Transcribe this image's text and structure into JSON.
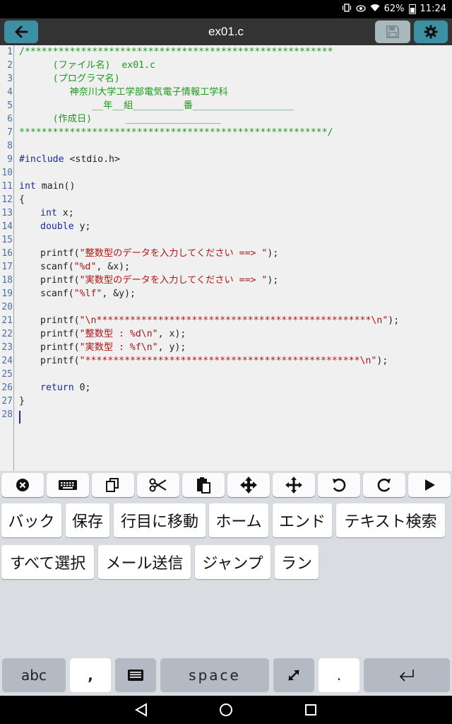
{
  "status": {
    "battery": "62%",
    "time": "11:24",
    "icons": [
      "vibrate-icon",
      "eye-icon",
      "wifi-icon",
      "battery-icon"
    ]
  },
  "toolbar": {
    "title": "ex01.c",
    "icons": [
      "back-arrow-icon",
      "floppy-disk-icon",
      "gear-icon"
    ]
  },
  "editor": {
    "line_numbers": [
      "1",
      "2",
      "3",
      "4",
      "5",
      "6",
      "7",
      "8",
      "9",
      "10",
      "11",
      "12",
      "13",
      "14",
      "15",
      "16",
      "17",
      "18",
      "19",
      "20",
      "21",
      "22",
      "23",
      "24",
      "25",
      "26",
      "27",
      "28"
    ],
    "lines": {
      "l1": "/*******************************************************",
      "l2": "      (ファイル名)  ex01.c",
      "l3": "      (プログラマ名)",
      "l4": "         神奈川大学工学部電気電子情報工学科",
      "l5": "             __年__組_________番__________________",
      "l6": "      (作成日)      _________________",
      "l7": "*******************************************************/",
      "l9a": "#include",
      "l9b": " <stdio.h>",
      "l11a": "int",
      "l11b": " main()",
      "l12": "{",
      "l13a": "int",
      "l13b": " x;",
      "l14a": "double",
      "l14b": " y;",
      "l16a": "printf(",
      "l16b": "\"整数型のデータを入力してください ==> \"",
      "l16c": ");",
      "l17a": "scanf(",
      "l17b": "\"%d\"",
      "l17c": ", &x);",
      "l18a": "printf(",
      "l18b": "\"実数型のデータを入力してください ==> \"",
      "l18c": ");",
      "l19a": "scanf(",
      "l19b": "\"%lf\"",
      "l19c": ", &y);",
      "l21a": "printf(",
      "l21b": "\"\\n*************************************************\\n\"",
      "l21c": ");",
      "l22a": "printf(",
      "l22b": "\"整数型 : %d\\n\"",
      "l22c": ", x);",
      "l23a": "printf(",
      "l23b": "\"実数型 : %f\\n\"",
      "l23c": ", y);",
      "l24a": "printf(",
      "l24b": "\"*************************************************\\n\"",
      "l24c": ");",
      "l26a": "return",
      "l26b": " 0;",
      "l27": "}"
    }
  },
  "key_icons": [
    "close-circle-icon",
    "keyboard-icon",
    "copy-icon",
    "cut-icon",
    "paste-icon",
    "move-cursor-icon",
    "move-icon",
    "undo-icon",
    "redo-icon",
    "play-icon"
  ],
  "menu": {
    "row1": [
      "バック",
      "保存",
      "行目に移動",
      "ホーム",
      "エンド",
      "テキスト検索"
    ],
    "row2": [
      "すべて選択",
      "メール送信",
      "ジャンプ",
      "ラン"
    ]
  },
  "keyboard": {
    "abc": "abc",
    "comma": ",",
    "space": "space",
    "period": "."
  },
  "navbar_icons": [
    "nav-back-icon",
    "nav-home-icon",
    "nav-recents-icon"
  ]
}
